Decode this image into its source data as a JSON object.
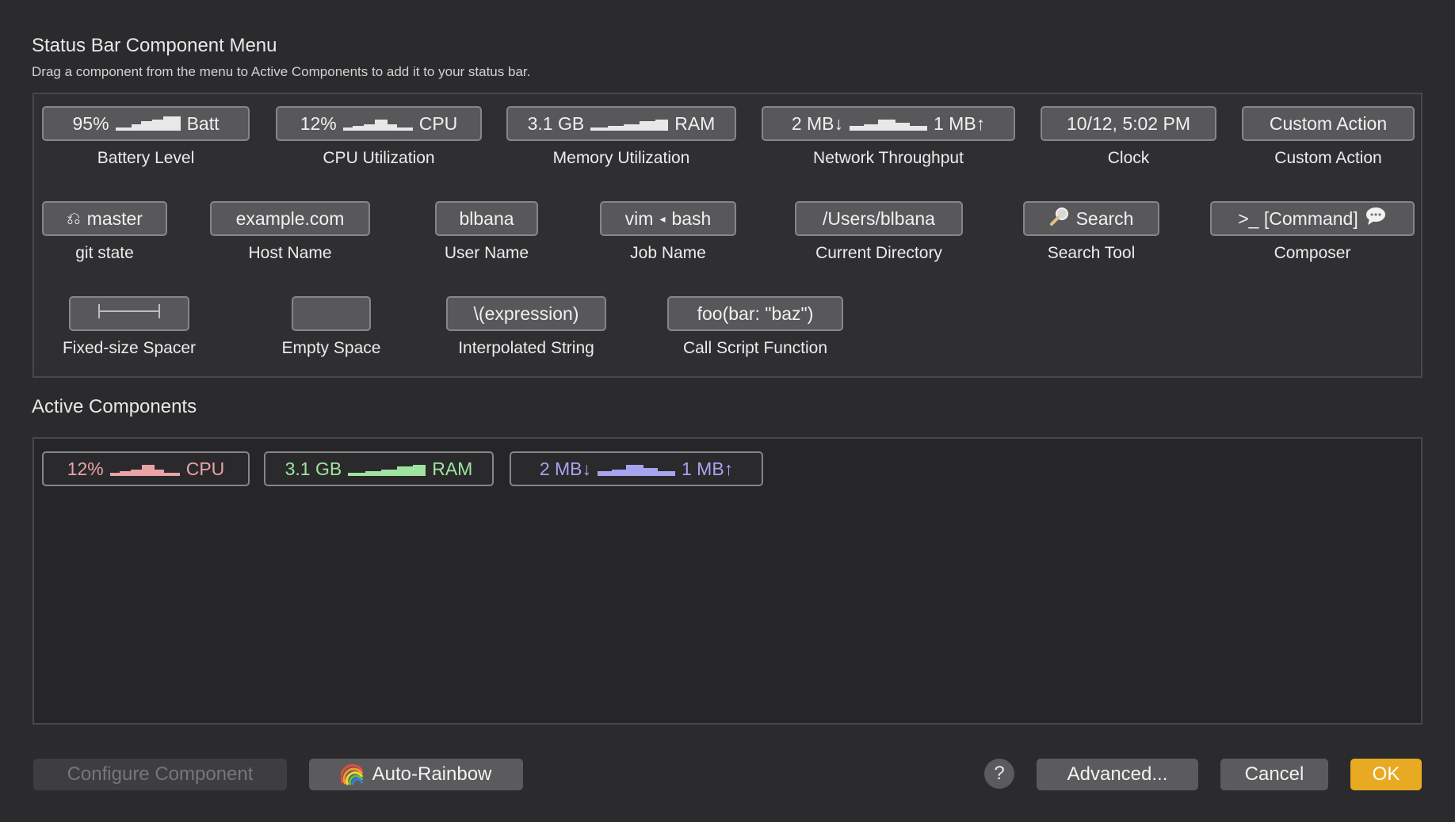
{
  "header": {
    "title": "Status Bar Component Menu",
    "subtitle": "Drag a component from the menu to Active Components to add it to your status bar."
  },
  "menu_components": [
    {
      "chip_left": "95%",
      "chip_right": "Batt",
      "label": "Battery Level",
      "icon": "sparkline-icon"
    },
    {
      "chip_left": "12%",
      "chip_right": "CPU",
      "label": "CPU Utilization",
      "icon": "sparkline-icon"
    },
    {
      "chip_left": "3.1 GB",
      "chip_right": "RAM",
      "label": "Memory Utilization",
      "icon": "sparkline-icon"
    },
    {
      "chip_left": "2 MB↓",
      "chip_right": "1 MB↑",
      "label": "Network Throughput",
      "icon": "sparkline-icon"
    },
    {
      "chip": "10/12, 5:02 PM",
      "label": "Clock"
    },
    {
      "chip": "Custom Action",
      "label": "Custom Action"
    },
    {
      "chip": "master",
      "label": "git state",
      "icon": "git-branch-icon"
    },
    {
      "chip": "example.com",
      "label": "Host Name"
    },
    {
      "chip": "blbana",
      "label": "User Name"
    },
    {
      "chip_left": "vim",
      "chip_right": "bash",
      "label": "Job Name",
      "icon": "triangle-left-icon"
    },
    {
      "chip": "/Users/blbana",
      "label": "Current Directory"
    },
    {
      "chip": "Search",
      "label": "Search Tool",
      "icon": "magnifier-icon"
    },
    {
      "chip": ">_ [Command]",
      "label": "Composer",
      "icon": "speech-bubble-icon"
    },
    {
      "chip": "",
      "label": "Fixed-size Spacer",
      "icon": "spacer-bracket-icon"
    },
    {
      "chip": "",
      "label": "Empty Space"
    },
    {
      "chip": "\\(expression)",
      "label": "Interpolated String"
    },
    {
      "chip": "foo(bar: \"baz\")",
      "label": "Call Script Function"
    }
  ],
  "active": {
    "title": "Active Components",
    "items": [
      {
        "left": "12%",
        "right": "CPU",
        "color": "#e9a3a6"
      },
      {
        "left": "3.1 GB",
        "right": "RAM",
        "color": "#9fe3a0"
      },
      {
        "left": "2 MB↓",
        "right": "1 MB↑",
        "color": "#a7a4ef"
      }
    ]
  },
  "footer": {
    "configure": "Configure Component",
    "auto_rainbow": "Auto-Rainbow",
    "help": "?",
    "advanced": "Advanced...",
    "cancel": "Cancel",
    "ok": "OK"
  }
}
